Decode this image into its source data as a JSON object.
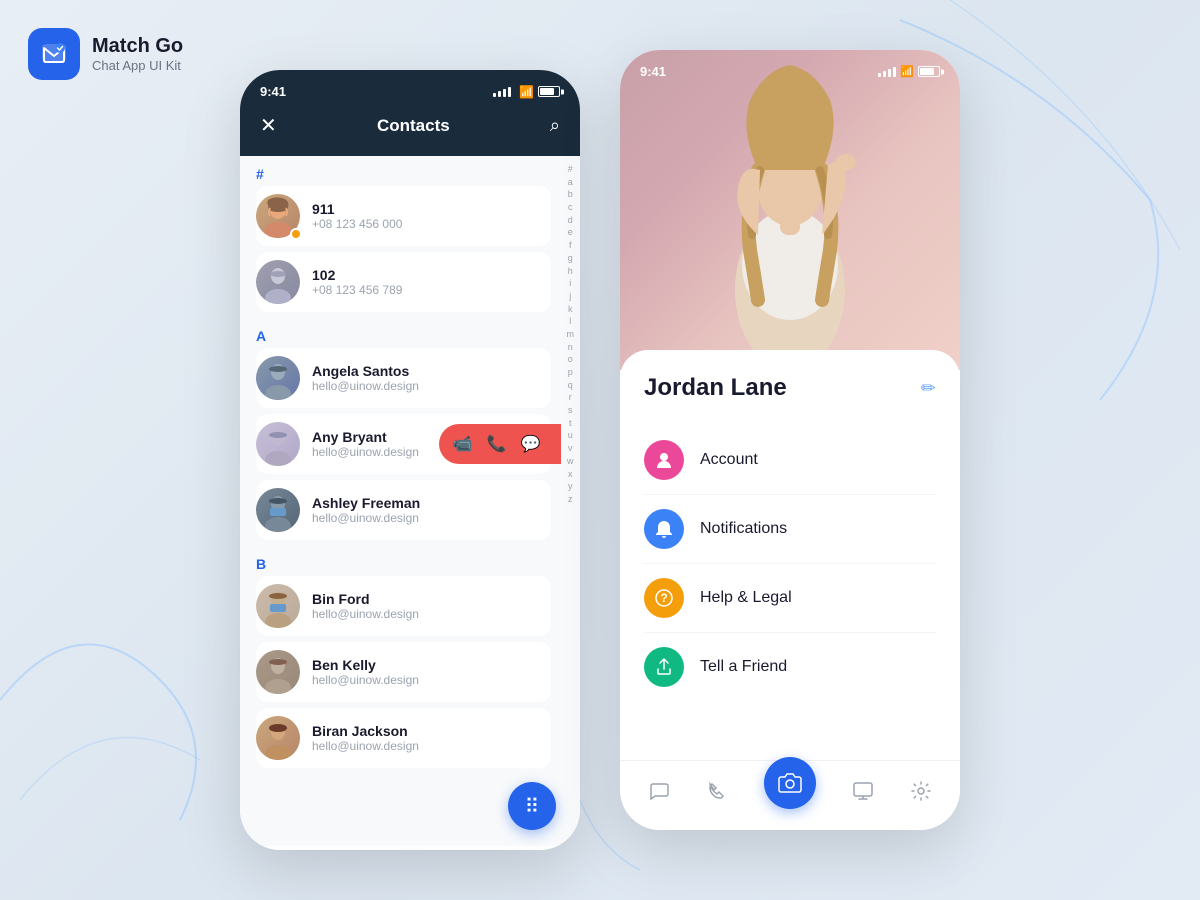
{
  "app": {
    "title": "Match Go",
    "subtitle": "Chat App UI Kit"
  },
  "leftPhone": {
    "time": "9:41",
    "title": "Contacts",
    "sections": {
      "hash": {
        "label": "#",
        "contacts": [
          {
            "id": 1,
            "name": "911",
            "phone": "+08 123 456 000",
            "starred": true,
            "avatarClass": "av-1"
          },
          {
            "id": 2,
            "name": "102",
            "phone": "+08 123 456 789",
            "starred": false,
            "avatarClass": "av-2"
          }
        ]
      },
      "a": {
        "label": "A",
        "contacts": [
          {
            "id": 3,
            "name": "Angela Santos",
            "phone": "hello@uinow.design",
            "starred": false,
            "avatarClass": "av-3"
          },
          {
            "id": 4,
            "name": "Any Bryant",
            "phone": "hello@uinow.design",
            "starred": false,
            "avatarClass": "av-4",
            "swiped": true
          }
        ]
      },
      "ashley": {
        "contacts": [
          {
            "id": 5,
            "name": "Ashley Freeman",
            "phone": "hello@uinow.design",
            "starred": false,
            "avatarClass": "av-5"
          }
        ]
      },
      "b": {
        "label": "B",
        "contacts": [
          {
            "id": 6,
            "name": "Bin Ford",
            "phone": "hello@uinow.design",
            "starred": false,
            "avatarClass": "av-6"
          },
          {
            "id": 7,
            "name": "Ben Kelly",
            "phone": "hello@uinow.design",
            "starred": false,
            "avatarClass": "av-7"
          },
          {
            "id": 8,
            "name": "Biran Jackson",
            "phone": "hello@uinow.design",
            "starred": false,
            "avatarClass": "av-1"
          }
        ]
      }
    },
    "alphaIndex": [
      "#",
      "a",
      "b",
      "c",
      "d",
      "e",
      "f",
      "g",
      "h",
      "i",
      "j",
      "k",
      "l",
      "m",
      "n",
      "o",
      "p",
      "q",
      "r",
      "s",
      "t",
      "u",
      "v",
      "w",
      "x",
      "y",
      "z"
    ],
    "swipeActions": [
      "📹",
      "📞",
      "💬"
    ]
  },
  "rightPhone": {
    "time": "9:41",
    "profileName": "Jordan Lane",
    "editLabel": "✏",
    "menuItems": [
      {
        "id": "account",
        "label": "Account",
        "iconClass": "pink",
        "icon": "👤"
      },
      {
        "id": "notifications",
        "label": "Notifications",
        "iconClass": "blue",
        "icon": "🔔"
      },
      {
        "id": "help",
        "label": "Help & Legal",
        "iconClass": "orange",
        "icon": "❓"
      },
      {
        "id": "friend",
        "label": "Tell a Friend",
        "iconClass": "teal",
        "icon": "📤"
      }
    ],
    "bottomNav": [
      {
        "id": "chat",
        "icon": "💬",
        "active": false
      },
      {
        "id": "call",
        "icon": "📞",
        "active": false
      },
      {
        "id": "camera",
        "icon": "📷",
        "active": true,
        "isCenter": true
      },
      {
        "id": "screen",
        "icon": "⬛",
        "active": false
      },
      {
        "id": "settings",
        "icon": "⚙",
        "active": false
      }
    ]
  }
}
